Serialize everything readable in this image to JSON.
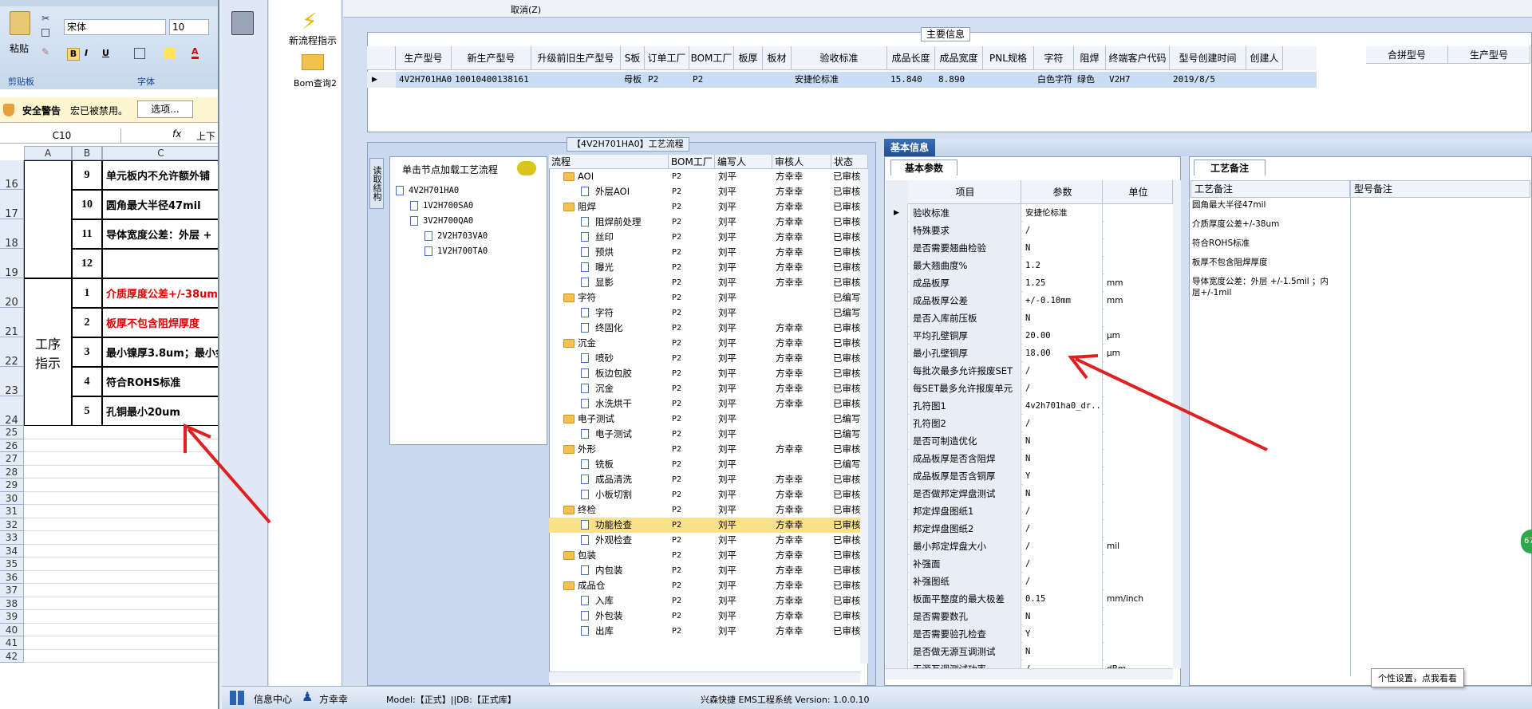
{
  "excel": {
    "font_name": "宋体",
    "font_size": "10",
    "paste_label": "粘贴",
    "clipboard_label": "剪贴板",
    "font_group_label": "字体",
    "security_warning": "安全警告",
    "macro_disabled": "宏已被禁用。",
    "options_button": "选项...",
    "name_box": "C10",
    "formula_text": "上下",
    "columns": [
      "A",
      "B",
      "C"
    ],
    "rows": [
      {
        "num": "16",
        "b": "9",
        "c": "单元板内不允许额外铺"
      },
      {
        "num": "17",
        "b": "10",
        "c": "圆角最大半径47mil"
      },
      {
        "num": "18",
        "b": "11",
        "c": "导体宽度公差：外层 +"
      },
      {
        "num": "19",
        "b": "12",
        "c": ""
      },
      {
        "num": "20",
        "b": "1",
        "c": "介质厚度公差+/-38um"
      },
      {
        "num": "21",
        "b": "2",
        "c": "板厚不包含阻焊厚度"
      },
      {
        "num": "22",
        "b": "3",
        "c": "最小镍厚3.8um；最小金"
      },
      {
        "num": "23",
        "b": "4",
        "c": "符合ROHS标准"
      },
      {
        "num": "24",
        "b": "5",
        "c": "孔铜最小20um"
      }
    ],
    "merged_label": "工序指示",
    "empty_rows": [
      "25",
      "26",
      "27",
      "28",
      "29",
      "30",
      "31",
      "32",
      "33",
      "34",
      "35",
      "36",
      "37",
      "38",
      "39",
      "40",
      "41",
      "42"
    ]
  },
  "sidebar": {
    "new_flow_label": "新流程指示",
    "bom_query_label": "Bom查询2"
  },
  "topbar": {
    "cancel_label": "取消(Z)"
  },
  "main_info": {
    "title": "主要信息",
    "headers": [
      "生产型号",
      "新生产型号",
      "升级前旧生产型号",
      "S板",
      "订单工厂",
      "BOM工厂",
      "板厚",
      "板材",
      "验收标准",
      "成品长度",
      "成品宽度",
      "PNL规格",
      "字符",
      "阻焊",
      "终端客户代码",
      "型号创建时间",
      "创建人"
    ],
    "row": [
      "4V2H701HA0",
      "10010400138161",
      "",
      "母板",
      "P2",
      "P2",
      "",
      "",
      "安捷伦标准",
      "15.840",
      "8.890",
      "",
      "白色字符",
      "绿色",
      "V2H7",
      "2019/8/5",
      ""
    ],
    "side_headers": [
      "合拼型号",
      "生产型号"
    ]
  },
  "process": {
    "title": "【4V2H701HA0】工艺流程",
    "left_tab": "读取结构",
    "hint": "单击节点加载工艺流程",
    "tree": [
      "4V2H701HA0",
      "1V2H700SA0",
      "3V2H700QA0",
      "2V2H703VA0",
      "1V2H700TA0"
    ],
    "headers": [
      "流程",
      "BOM工厂",
      "编写人",
      "审核人",
      "状态"
    ],
    "rows": [
      {
        "name": "AOI",
        "level": 0,
        "bom": "P2",
        "writer": "刘平",
        "reviewer": "方幸幸",
        "status": "已审核"
      },
      {
        "name": "外层AOI",
        "level": 1,
        "bom": "P2",
        "writer": "刘平",
        "reviewer": "方幸幸",
        "status": "已审核"
      },
      {
        "name": "阻焊",
        "level": 0,
        "bom": "P2",
        "writer": "刘平",
        "reviewer": "方幸幸",
        "status": "已审核"
      },
      {
        "name": "阻焊前处理",
        "level": 1,
        "bom": "P2",
        "writer": "刘平",
        "reviewer": "方幸幸",
        "status": "已审核"
      },
      {
        "name": "丝印",
        "level": 1,
        "bom": "P2",
        "writer": "刘平",
        "reviewer": "方幸幸",
        "status": "已审核"
      },
      {
        "name": "预烘",
        "level": 1,
        "bom": "P2",
        "writer": "刘平",
        "reviewer": "方幸幸",
        "status": "已审核"
      },
      {
        "name": "曝光",
        "level": 1,
        "bom": "P2",
        "writer": "刘平",
        "reviewer": "方幸幸",
        "status": "已审核"
      },
      {
        "name": "显影",
        "level": 1,
        "bom": "P2",
        "writer": "刘平",
        "reviewer": "方幸幸",
        "status": "已审核"
      },
      {
        "name": "字符",
        "level": 0,
        "bom": "P2",
        "writer": "刘平",
        "reviewer": "",
        "status": "已编写"
      },
      {
        "name": "字符",
        "level": 1,
        "bom": "P2",
        "writer": "刘平",
        "reviewer": "",
        "status": "已编写"
      },
      {
        "name": "终固化",
        "level": 1,
        "bom": "P2",
        "writer": "刘平",
        "reviewer": "方幸幸",
        "status": "已审核"
      },
      {
        "name": "沉金",
        "level": 0,
        "bom": "P2",
        "writer": "刘平",
        "reviewer": "方幸幸",
        "status": "已审核"
      },
      {
        "name": "喷砂",
        "level": 1,
        "bom": "P2",
        "writer": "刘平",
        "reviewer": "方幸幸",
        "status": "已审核"
      },
      {
        "name": "板边包胶",
        "level": 1,
        "bom": "P2",
        "writer": "刘平",
        "reviewer": "方幸幸",
        "status": "已审核"
      },
      {
        "name": "沉金",
        "level": 1,
        "bom": "P2",
        "writer": "刘平",
        "reviewer": "方幸幸",
        "status": "已审核"
      },
      {
        "name": "水洗烘干",
        "level": 1,
        "bom": "P2",
        "writer": "刘平",
        "reviewer": "方幸幸",
        "status": "已审核"
      },
      {
        "name": "电子测试",
        "level": 0,
        "bom": "P2",
        "writer": "刘平",
        "reviewer": "",
        "status": "已编写"
      },
      {
        "name": "电子测试",
        "level": 1,
        "bom": "P2",
        "writer": "刘平",
        "reviewer": "",
        "status": "已编写"
      },
      {
        "name": "外形",
        "level": 0,
        "bom": "P2",
        "writer": "刘平",
        "reviewer": "方幸幸",
        "status": "已审核"
      },
      {
        "name": "铣板",
        "level": 1,
        "bom": "P2",
        "writer": "刘平",
        "reviewer": "",
        "status": "已编写"
      },
      {
        "name": "成品清洗",
        "level": 1,
        "bom": "P2",
        "writer": "刘平",
        "reviewer": "方幸幸",
        "status": "已审核"
      },
      {
        "name": "小板切割",
        "level": 1,
        "bom": "P2",
        "writer": "刘平",
        "reviewer": "方幸幸",
        "status": "已审核"
      },
      {
        "name": "终检",
        "level": 0,
        "bom": "P2",
        "writer": "刘平",
        "reviewer": "方幸幸",
        "status": "已审核"
      },
      {
        "name": "功能检查",
        "level": 1,
        "bom": "P2",
        "writer": "刘平",
        "reviewer": "方幸幸",
        "status": "已审核",
        "selected": true
      },
      {
        "name": "外观检查",
        "level": 1,
        "bom": "P2",
        "writer": "刘平",
        "reviewer": "方幸幸",
        "status": "已审核"
      },
      {
        "name": "包装",
        "level": 0,
        "bom": "P2",
        "writer": "刘平",
        "reviewer": "方幸幸",
        "status": "已审核"
      },
      {
        "name": "内包装",
        "level": 1,
        "bom": "P2",
        "writer": "刘平",
        "reviewer": "方幸幸",
        "status": "已审核"
      },
      {
        "name": "成品仓",
        "level": 0,
        "bom": "P2",
        "writer": "刘平",
        "reviewer": "方幸幸",
        "status": "已审核"
      },
      {
        "name": "入库",
        "level": 1,
        "bom": "P2",
        "writer": "刘平",
        "reviewer": "方幸幸",
        "status": "已审核"
      },
      {
        "name": "外包装",
        "level": 1,
        "bom": "P2",
        "writer": "刘平",
        "reviewer": "方幸幸",
        "status": "已审核"
      },
      {
        "name": "出库",
        "level": 1,
        "bom": "P2",
        "writer": "刘平",
        "reviewer": "方幸幸",
        "status": "已审核"
      }
    ]
  },
  "basic": {
    "title": "基本信息",
    "tab": "基本参数",
    "headers": [
      "项目",
      "参数",
      "单位"
    ],
    "rows": [
      {
        "item": "验收标准",
        "param": "安捷伦标准",
        "unit": ""
      },
      {
        "item": "特殊要求",
        "param": "/",
        "unit": ""
      },
      {
        "item": "是否需要翘曲检验",
        "param": "N",
        "unit": ""
      },
      {
        "item": "最大翘曲度%",
        "param": "1.2",
        "unit": ""
      },
      {
        "item": "成品板厚",
        "param": "1.25",
        "unit": "mm"
      },
      {
        "item": "成品板厚公差",
        "param": "+/-0.10mm",
        "unit": "mm"
      },
      {
        "item": "是否入库前压板",
        "param": "N",
        "unit": ""
      },
      {
        "item": "平均孔壁铜厚",
        "param": "20.00",
        "unit": "μm"
      },
      {
        "item": "最小孔壁铜厚",
        "param": "18.00",
        "unit": "μm"
      },
      {
        "item": "每批次最多允许报废SET",
        "param": "/",
        "unit": ""
      },
      {
        "item": "每SET最多允许报废单元",
        "param": "/",
        "unit": ""
      },
      {
        "item": "孔符图1",
        "param": "4v2h701ha0_dr...",
        "unit": ""
      },
      {
        "item": "孔符图2",
        "param": "/",
        "unit": ""
      },
      {
        "item": "是否可制造优化",
        "param": "N",
        "unit": ""
      },
      {
        "item": "成品板厚是否含阻焊",
        "param": "N",
        "unit": ""
      },
      {
        "item": "成品板厚是否含铜厚",
        "param": "Y",
        "unit": ""
      },
      {
        "item": "是否做邦定焊盘测试",
        "param": "N",
        "unit": ""
      },
      {
        "item": "邦定焊盘图纸1",
        "param": "/",
        "unit": ""
      },
      {
        "item": "邦定焊盘图纸2",
        "param": "/",
        "unit": ""
      },
      {
        "item": "最小邦定焊盘大小",
        "param": "/",
        "unit": "mil"
      },
      {
        "item": "补强面",
        "param": "/",
        "unit": ""
      },
      {
        "item": "补强图纸",
        "param": "/",
        "unit": ""
      },
      {
        "item": "板面平整度的最大极差",
        "param": "0.15",
        "unit": "mm/inch"
      },
      {
        "item": "是否需要数孔",
        "param": "N",
        "unit": ""
      },
      {
        "item": "是否需要验孔检查",
        "param": "Y",
        "unit": ""
      },
      {
        "item": "是否做无源互调测试",
        "param": "N",
        "unit": ""
      },
      {
        "item": "无源互调测试功率",
        "param": "/",
        "unit": "dBm"
      }
    ]
  },
  "notes": {
    "tab": "工艺备注",
    "col1": "工艺备注",
    "col2": "型号备注",
    "lines": [
      "圆角最大半径47mil",
      "介质厚度公差+/-38um",
      "符合ROHS标准",
      "板厚不包含阻焊厚度",
      "导体宽度公差：外层 +/-1.5mil ；内层+/-1mil"
    ]
  },
  "statusbar": {
    "info_center": "信息中心",
    "user": "方幸幸",
    "model": "Model:【正式】||DB:【正式库】",
    "system": "兴森快捷 EMS工程系统 Version: 1.0.0.10",
    "tooltip": "个性设置，点我看看",
    "badge": "67"
  }
}
